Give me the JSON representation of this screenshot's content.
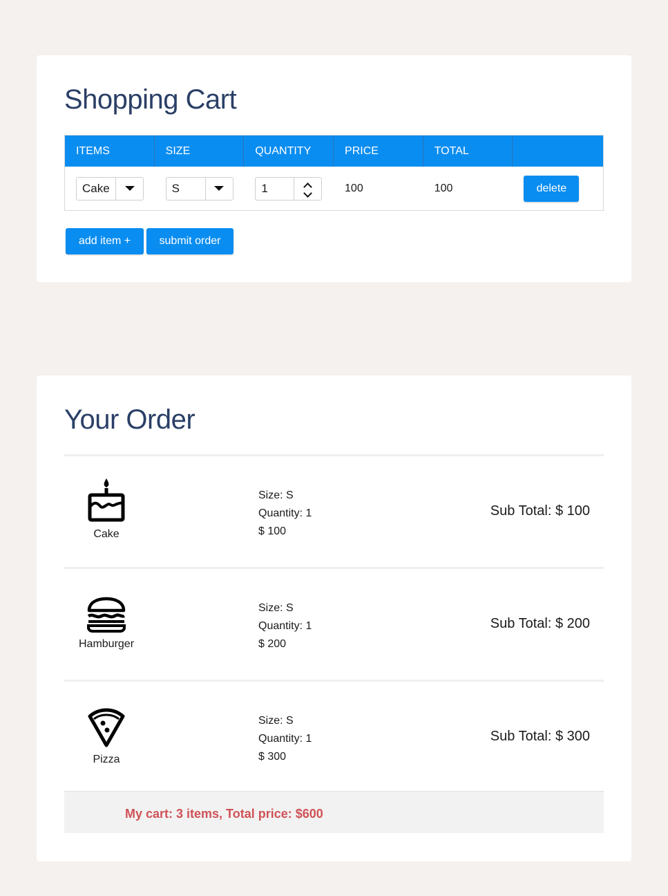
{
  "cart": {
    "title": "Shopping Cart",
    "columns": [
      "ITEMS",
      "SIZE",
      "QUANTITY",
      "PRICE",
      "TOTAL",
      ""
    ],
    "row": {
      "item": "Cake",
      "size": "S",
      "quantity": "1",
      "price": "100",
      "total": "100",
      "delete_label": "delete"
    },
    "add_label": "add item +",
    "submit_label": "submit order"
  },
  "order": {
    "title": "Your Order",
    "items": [
      {
        "icon": "cake-icon",
        "name": "Cake",
        "size": "Size: S",
        "quantity": "Quantity: 1",
        "price": "$ 100",
        "subtotal": "Sub Total: $ 100"
      },
      {
        "icon": "hamburger-icon",
        "name": "Hamburger",
        "size": "Size: S",
        "quantity": "Quantity: 1",
        "price": "$ 200",
        "subtotal": "Sub Total: $ 200"
      },
      {
        "icon": "pizza-icon",
        "name": "Pizza",
        "size": "Size: S",
        "quantity": "Quantity: 1",
        "price": "$ 300",
        "subtotal": "Sub Total: $ 300"
      }
    ],
    "summary": "My cart: 3 items, Total price: $600"
  },
  "colors": {
    "accent": "#0a8df0",
    "title": "#2a3f66",
    "summary": "#cf5257",
    "background": "#f5f1ee"
  }
}
